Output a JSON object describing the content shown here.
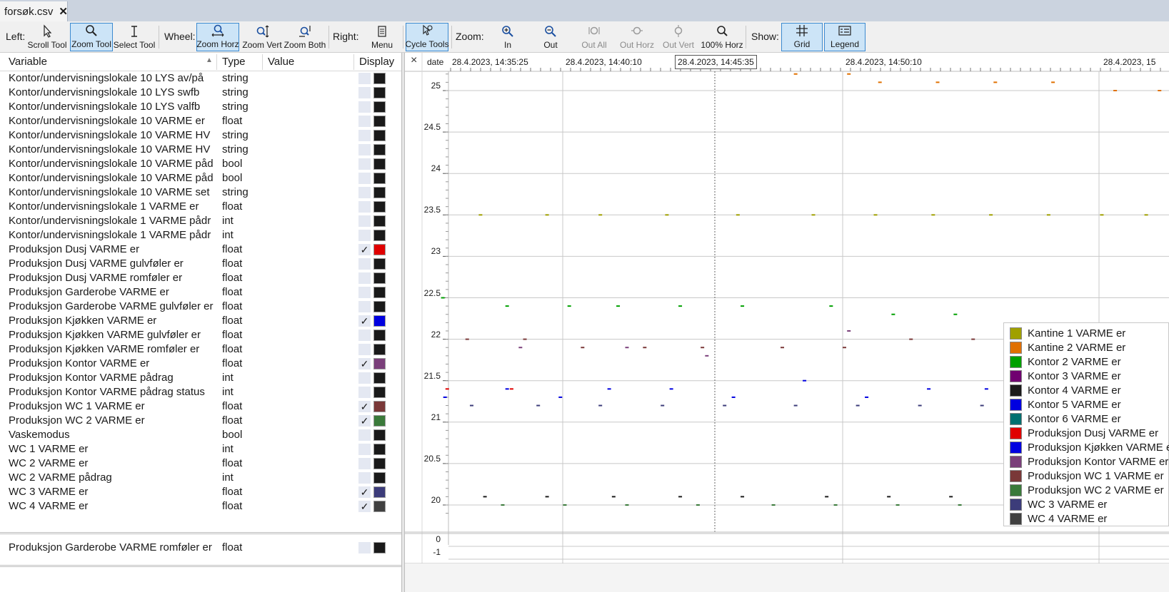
{
  "tab": {
    "title": "forsøk.csv",
    "close": "✕"
  },
  "toolbar": {
    "left_label": "Left:",
    "wheel_label": "Wheel:",
    "right_label": "Right:",
    "zoom_label": "Zoom:",
    "show_label": "Show:",
    "scroll_tool": "Scroll Tool",
    "zoom_tool": "Zoom Tool",
    "select_tool": "Select Tool",
    "zoom_horz": "Zoom Horz",
    "zoom_vert": "Zoom Vert",
    "zoom_both": "Zoom Both",
    "menu": "Menu",
    "cycle_tools": "Cycle Tools",
    "zoom_in": "In",
    "zoom_out": "Out",
    "out_all": "Out All",
    "out_horz": "Out Horz",
    "out_vert": "Out Vert",
    "horz_100": "100% Horz",
    "grid": "Grid",
    "legend": "Legend"
  },
  "list_header": {
    "variable": "Variable",
    "type": "Type",
    "value": "Value",
    "display": "Display"
  },
  "variables": [
    {
      "name": "Kontor/undervisningslokale 10 LYS av/på",
      "type": "string",
      "checked": false,
      "color": "#1a1a1a"
    },
    {
      "name": "Kontor/undervisningslokale 10 LYS swfb",
      "type": "string",
      "checked": false,
      "color": "#1a1a1a"
    },
    {
      "name": "Kontor/undervisningslokale 10 LYS valfb",
      "type": "string",
      "checked": false,
      "color": "#1a1a1a"
    },
    {
      "name": "Kontor/undervisningslokale 10 VARME er",
      "type": "float",
      "checked": false,
      "color": "#1a1a1a"
    },
    {
      "name": "Kontor/undervisningslokale 10 VARME HV",
      "type": "string",
      "checked": false,
      "color": "#1a1a1a"
    },
    {
      "name": "Kontor/undervisningslokale 10 VARME HV",
      "type": "string",
      "checked": false,
      "color": "#1a1a1a"
    },
    {
      "name": "Kontor/undervisningslokale 10 VARME påd",
      "type": "bool",
      "checked": false,
      "color": "#1a1a1a"
    },
    {
      "name": "Kontor/undervisningslokale 10 VARME påd",
      "type": "bool",
      "checked": false,
      "color": "#1a1a1a"
    },
    {
      "name": "Kontor/undervisningslokale 10 VARME set",
      "type": "string",
      "checked": false,
      "color": "#1a1a1a"
    },
    {
      "name": "Kontor/undervisningslokale 1 VARME er",
      "type": "float",
      "checked": false,
      "color": "#1a1a1a"
    },
    {
      "name": "Kontor/undervisningslokale 1 VARME pådr",
      "type": "int",
      "checked": false,
      "color": "#1a1a1a"
    },
    {
      "name": "Kontor/undervisningslokale 1 VARME pådr",
      "type": "int",
      "checked": false,
      "color": "#1a1a1a"
    },
    {
      "name": "Produksjon Dusj VARME er",
      "type": "float",
      "checked": true,
      "color": "#e00000"
    },
    {
      "name": "Produksjon Dusj VARME gulvføler er",
      "type": "float",
      "checked": false,
      "color": "#1a1a1a"
    },
    {
      "name": "Produksjon Dusj VARME romføler er",
      "type": "float",
      "checked": false,
      "color": "#1a1a1a"
    },
    {
      "name": "Produksjon Garderobe VARME er",
      "type": "float",
      "checked": false,
      "color": "#1a1a1a"
    },
    {
      "name": "Produksjon Garderobe VARME gulvføler er",
      "type": "float",
      "checked": false,
      "color": "#1a1a1a"
    },
    {
      "name": "Produksjon Kjøkken VARME er",
      "type": "float",
      "checked": true,
      "color": "#0000e0"
    },
    {
      "name": "Produksjon Kjøkken VARME gulvføler er",
      "type": "float",
      "checked": false,
      "color": "#1a1a1a"
    },
    {
      "name": "Produksjon Kjøkken VARME romføler er",
      "type": "float",
      "checked": false,
      "color": "#1a1a1a"
    },
    {
      "name": "Produksjon Kontor VARME er",
      "type": "float",
      "checked": true,
      "color": "#7a3f7a"
    },
    {
      "name": "Produksjon Kontor VARME pådrag",
      "type": "int",
      "checked": false,
      "color": "#1a1a1a"
    },
    {
      "name": "Produksjon Kontor VARME pådrag status",
      "type": "int",
      "checked": false,
      "color": "#1a1a1a"
    },
    {
      "name": "Produksjon WC 1 VARME er",
      "type": "float",
      "checked": true,
      "color": "#7a3838"
    },
    {
      "name": "Produksjon WC 2 VARME er",
      "type": "float",
      "checked": true,
      "color": "#3a7a3a"
    },
    {
      "name": "Vaskemodus",
      "type": "bool",
      "checked": false,
      "color": "#1a1a1a"
    },
    {
      "name": "WC 1 VARME er",
      "type": "int",
      "checked": false,
      "color": "#1a1a1a"
    },
    {
      "name": "WC 2 VARME er",
      "type": "float",
      "checked": false,
      "color": "#1a1a1a"
    },
    {
      "name": "WC 2 VARME pådrag",
      "type": "int",
      "checked": false,
      "color": "#1a1a1a"
    },
    {
      "name": "WC 3 VARME er",
      "type": "float",
      "checked": true,
      "color": "#3c3c7a"
    },
    {
      "name": "WC 4 VARME er",
      "type": "float",
      "checked": true,
      "color": "#404040"
    }
  ],
  "pinned_variables": [
    {
      "name": "Produksjon Garderobe VARME romføler er",
      "type": "float",
      "checked": false,
      "color": "#1a1a1a"
    }
  ],
  "chart": {
    "close": "×",
    "date_label": "date",
    "x_ticks": [
      "28.4.2023, 14:35:25",
      "28.4.2023, 14:40:10",
      "28.4.2023, 14:45:35",
      "28.4.2023, 14:50:10",
      "28.4.2023, 15"
    ],
    "y_ticks": [
      "25",
      "24.5",
      "24",
      "23.5",
      "23",
      "22.5",
      "22",
      "21.5",
      "21",
      "20.5",
      "20"
    ],
    "y_ticks_lower": [
      "0",
      "-1"
    ]
  },
  "legend": [
    {
      "name": "Kantine 1 VARME er",
      "color": "#a0a000"
    },
    {
      "name": "Kantine 2 VARME er",
      "color": "#e07000"
    },
    {
      "name": "Kontor 2 VARME er",
      "color": "#00a000"
    },
    {
      "name": "Kontor 3 VARME er",
      "color": "#700070"
    },
    {
      "name": "Kontor 4 VARME er",
      "color": "#1a1a1a"
    },
    {
      "name": "Kontor 5 VARME er",
      "color": "#0000e0"
    },
    {
      "name": "Kontor 6 VARME er",
      "color": "#007070"
    },
    {
      "name": "Produksjon Dusj VARME er",
      "color": "#e00000"
    },
    {
      "name": "Produksjon Kjøkken VARME er",
      "color": "#0000e0"
    },
    {
      "name": "Produksjon Kontor VARME er",
      "color": "#7a3f7a"
    },
    {
      "name": "Produksjon WC 1 VARME er",
      "color": "#7a3838"
    },
    {
      "name": "Produksjon WC 2 VARME er",
      "color": "#3a7a3a"
    },
    {
      "name": "WC 3 VARME er",
      "color": "#3c3c7a"
    },
    {
      "name": "WC 4 VARME er",
      "color": "#404040"
    }
  ],
  "chart_data": {
    "type": "scatter",
    "x_axis_label": "date",
    "x_ticks": [
      "28.4.2023, 14:35:25",
      "28.4.2023, 14:40:10",
      "28.4.2023, 14:45:35",
      "28.4.2023, 14:50:10"
    ],
    "ylim": [
      19.8,
      25.2
    ],
    "grid": true,
    "legend_position": "bottom-right",
    "series": [
      {
        "name": "Kantine 1 VARME er",
        "color": "#a0a000",
        "x": [
          "14:36:30",
          "14:39:00",
          "14:41:00",
          "14:43:30",
          "14:46:10",
          "14:49:00",
          "14:51:20",
          "14:53:30",
          "14:55:40",
          "14:57:50",
          "14:59:50",
          "15:01:30"
        ],
        "y": [
          23.5,
          23.5,
          23.5,
          23.5,
          23.5,
          23.5,
          23.5,
          23.5,
          23.5,
          23.5,
          23.5,
          23.5
        ]
      },
      {
        "name": "Kantine 2 VARME er",
        "color": "#e07000",
        "x": [
          "14:48:20",
          "14:50:20",
          "14:51:30",
          "14:53:40",
          "14:55:50",
          "14:58:00",
          "15:00:20",
          "15:02:00"
        ],
        "y": [
          25.2,
          25.2,
          25.1,
          25.1,
          25.1,
          25.1,
          25.0,
          25.0
        ]
      },
      {
        "name": "Kontor 2 VARME er",
        "color": "#00a000",
        "x": [
          "14:35:05",
          "14:37:30",
          "14:39:50",
          "14:41:40",
          "14:44:00",
          "14:46:20",
          "14:49:40",
          "14:52:00",
          "14:54:20"
        ],
        "y": [
          22.5,
          22.4,
          22.4,
          22.4,
          22.4,
          22.4,
          22.4,
          22.3,
          22.3
        ]
      },
      {
        "name": "Kontor 4 VARME er",
        "color": "#1a1a1a",
        "x": [
          "14:36:40",
          "14:39:00",
          "14:41:30",
          "14:44:00",
          "14:46:20",
          "14:49:30",
          "14:51:50",
          "14:54:10",
          "14:56:20",
          "14:58:30"
        ],
        "y": [
          20.1,
          20.1,
          20.1,
          20.1,
          20.1,
          20.1,
          20.1,
          20.1,
          20.1,
          20.1
        ]
      },
      {
        "name": "Kontor 5 VARME er",
        "color": "#0000e0",
        "x": [
          "14:35:10",
          "14:37:30",
          "14:39:30",
          "14:41:20",
          "14:43:40",
          "14:46:00",
          "14:48:40",
          "14:51:00",
          "14:53:20",
          "14:55:30",
          "14:57:40"
        ],
        "y": [
          21.3,
          21.4,
          21.3,
          21.4,
          21.4,
          21.3,
          21.5,
          21.3,
          21.4,
          21.4,
          21.4
        ]
      },
      {
        "name": "Produksjon Dusj VARME er",
        "color": "#e00000",
        "x": [
          "14:35:15",
          "14:37:40"
        ],
        "y": [
          21.4,
          21.4
        ]
      },
      {
        "name": "Produksjon Kontor VARME er",
        "color": "#7a3f7a",
        "x": [
          "14:38:00",
          "14:42:00",
          "14:45:00",
          "14:50:20"
        ],
        "y": [
          21.9,
          21.9,
          21.8,
          22.1
        ]
      },
      {
        "name": "Produksjon WC 1 VARME er",
        "color": "#7a3838",
        "x": [
          "14:36:00",
          "14:38:10",
          "14:40:20",
          "14:42:40",
          "14:44:50",
          "14:47:50",
          "14:50:10",
          "14:52:40",
          "14:55:00"
        ],
        "y": [
          22.0,
          22.0,
          21.9,
          21.9,
          21.9,
          21.9,
          21.9,
          22.0,
          22.0
        ]
      },
      {
        "name": "Produksjon WC 2 VARME er",
        "color": "#3a7a3a",
        "x": [
          "14:37:20",
          "14:39:40",
          "14:42:00",
          "14:44:40",
          "14:47:30",
          "14:49:50",
          "14:52:10",
          "14:54:30"
        ],
        "y": [
          20.0,
          20.0,
          20.0,
          20.0,
          20.0,
          20.0,
          20.0,
          20.0
        ]
      },
      {
        "name": "WC 3 VARME er",
        "color": "#3c3c7a",
        "x": [
          "14:36:10",
          "14:38:40",
          "14:41:00",
          "14:43:20",
          "14:45:40",
          "14:48:20",
          "14:50:40",
          "14:53:00",
          "14:55:20",
          "14:57:30"
        ],
        "y": [
          21.2,
          21.2,
          21.2,
          21.2,
          21.2,
          21.2,
          21.2,
          21.2,
          21.2,
          21.2
        ]
      }
    ]
  }
}
